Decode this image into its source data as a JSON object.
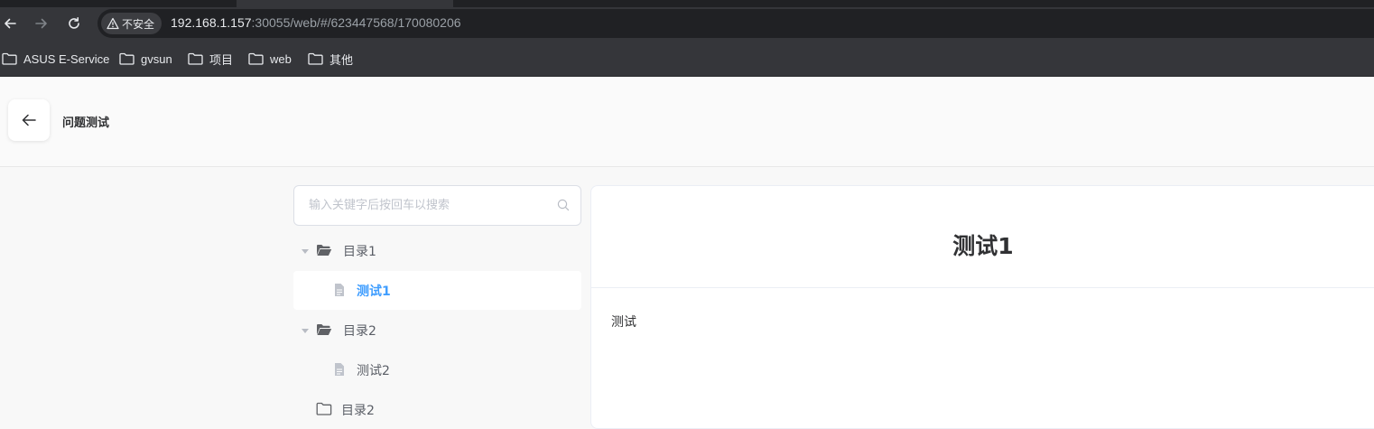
{
  "browser": {
    "security_label": "不安全",
    "url_host": "192.168.1.157",
    "url_rest": ":30055/web/#/623447568/170080206",
    "bookmarks": [
      {
        "label": "ASUS E-Service",
        "icon": "folder-icon"
      },
      {
        "label": "gvsun",
        "icon": "folder-icon"
      },
      {
        "label": "项目",
        "icon": "folder-icon"
      },
      {
        "label": "web",
        "icon": "folder-icon"
      },
      {
        "label": "其他",
        "icon": "folder-icon"
      }
    ]
  },
  "header": {
    "title": "问题测试",
    "back_icon": "arrow-left-icon"
  },
  "sidebar": {
    "search_placeholder": "输入关键字后按回车以搜索",
    "tree": [
      {
        "label": "目录1",
        "type": "folder",
        "expanded": true
      },
      {
        "label": "测试1",
        "type": "document",
        "selected": true
      },
      {
        "label": "目录2",
        "type": "folder",
        "expanded": true
      },
      {
        "label": "测试2",
        "type": "document",
        "selected": false
      },
      {
        "label": "目录2",
        "type": "folder",
        "expanded": false
      }
    ]
  },
  "content": {
    "title": "测试1",
    "body": "测试"
  },
  "colors": {
    "accent": "#409eff",
    "browser_chrome": "#35363a",
    "page_bg": "#f8f8f8"
  }
}
